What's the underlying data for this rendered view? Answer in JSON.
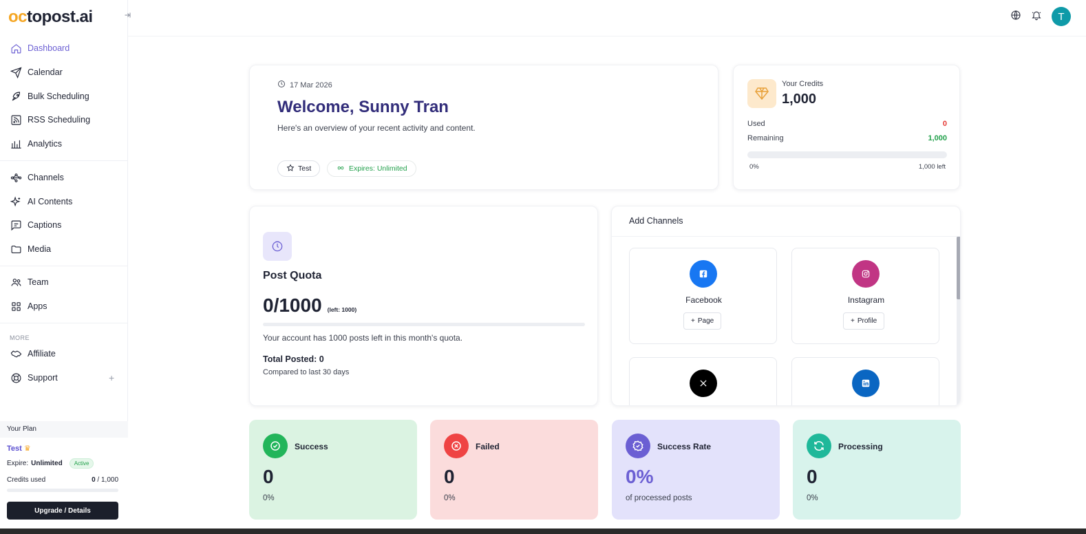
{
  "brand": {
    "logo_oc": "oc",
    "logo_rest": "topost.ai"
  },
  "colors": {
    "accent": "#6b5fd3",
    "title": "#322d7a",
    "success": "#22a04b",
    "danger": "#e53935",
    "brand_orange": "#f5a623"
  },
  "sidebar": {
    "items": [
      {
        "label": "Dashboard",
        "icon": "home-icon",
        "active": true
      },
      {
        "label": "Calendar",
        "icon": "send-icon"
      },
      {
        "label": "Bulk Scheduling",
        "icon": "rocket-icon"
      },
      {
        "label": "RSS Scheduling",
        "icon": "rss-icon"
      },
      {
        "label": "Analytics",
        "icon": "bar-chart-icon"
      },
      {
        "label": "Channels",
        "icon": "network-icon"
      },
      {
        "label": "AI Contents",
        "icon": "sparkles-icon"
      },
      {
        "label": "Captions",
        "icon": "message-square-icon"
      },
      {
        "label": "Media",
        "icon": "folder-icon"
      },
      {
        "label": "Team",
        "icon": "users-icon"
      },
      {
        "label": "Apps",
        "icon": "grid-icon"
      },
      {
        "label": "Affiliate",
        "icon": "handshake-icon"
      },
      {
        "label": "Support",
        "icon": "lifebuoy-icon"
      }
    ],
    "more_label": "MORE",
    "support_plus": "+"
  },
  "plan": {
    "header": "Your Plan",
    "name": "Test",
    "crown": "♛",
    "expire_label": "Expire:",
    "expire_value": "Unlimited",
    "status": "Active",
    "credits_label": "Credits used",
    "credits_used": "0",
    "credits_total": " / 1,000",
    "upgrade_label": "Upgrade / Details"
  },
  "header": {
    "avatar_letter": "T"
  },
  "welcome": {
    "date": "17 Mar 2026",
    "title": "Welcome, Sunny Tran",
    "subtitle": "Here's an overview of your recent activity and content.",
    "plan_pill": "Test",
    "expires_pill": "Expires: Unlimited"
  },
  "credits": {
    "label": "Your Credits",
    "value": "1,000",
    "used_label": "Used",
    "used_value": "0",
    "remaining_label": "Remaining",
    "remaining_value": "1,000",
    "bar_start": "0%",
    "bar_end": "1,000 left"
  },
  "quota": {
    "title": "Post Quota",
    "value": "0/1000",
    "left": "(left: 1000)",
    "description": "Your account has 1000 posts left in this month's quota.",
    "total_posted": "Total Posted: 0",
    "compared": "Compared to last 30 days"
  },
  "channels": {
    "title": "Add Channels",
    "cards": [
      {
        "name": "Facebook",
        "button": "Page",
        "color": "#1877f2"
      },
      {
        "name": "Instagram",
        "button": "Profile",
        "color": "#c13584"
      },
      {
        "name": "X",
        "color": "#000000"
      },
      {
        "name": "LinkedIn",
        "color": "#0a66c2"
      }
    ]
  },
  "stats": [
    {
      "label": "Success",
      "value": "0",
      "sub": "0%",
      "bg": "#dbf3e2",
      "icon_bg": "#22b55a"
    },
    {
      "label": "Failed",
      "value": "0",
      "sub": "0%",
      "bg": "#fbdcdc",
      "icon_bg": "#ef4444"
    },
    {
      "label": "Success Rate",
      "value": "0%",
      "sub": "of processed posts",
      "bg": "#e3e2fb",
      "icon_bg": "#6b5fd3"
    },
    {
      "label": "Processing",
      "value": "0",
      "sub": "0%",
      "bg": "#d8f3ec",
      "icon_bg": "#1fb89a"
    }
  ]
}
